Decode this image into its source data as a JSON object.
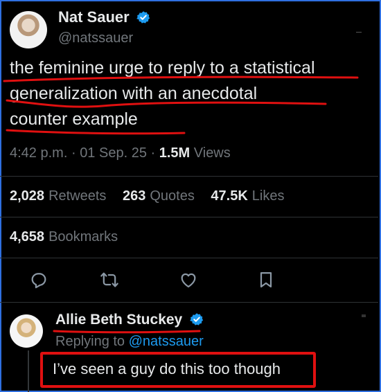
{
  "tweet": {
    "author_name": "Nat Sauer",
    "author_handle": "@natssauer",
    "text_line1": "the feminine urge to reply to a statistical",
    "text_line2": "generalization with an anecdotal",
    "text_line3": "counter example",
    "time": "4:42 p.m.",
    "sep1": "·",
    "date": "01 Sep. 25",
    "sep2": "·",
    "views_count": "1.5M",
    "views_label": "Views",
    "retweets_count": "2,028",
    "retweets_label": "Retweets",
    "quotes_count": "263",
    "quotes_label": "Quotes",
    "likes_count": "47.5K",
    "likes_label": "Likes",
    "bookmarks_count": "4,658",
    "bookmarks_label": "Bookmarks"
  },
  "actions": {
    "reply_icon": "reply-icon",
    "retweet_icon": "retweet-icon",
    "like_icon": "heart-icon",
    "bookmark_icon": "bookmark-icon"
  },
  "reply": {
    "author_name": "Allie Beth Stuckey",
    "replying_prefix": "Replying to",
    "replying_handle": "@natssauer",
    "text": "I’ve seen a guy do this too though"
  },
  "colors": {
    "background": "#000000",
    "text": "#e7e9ea",
    "muted": "#71767b",
    "link": "#1d9bf0",
    "annotation_red": "#e01010",
    "frame_blue": "#2f6fe0"
  }
}
